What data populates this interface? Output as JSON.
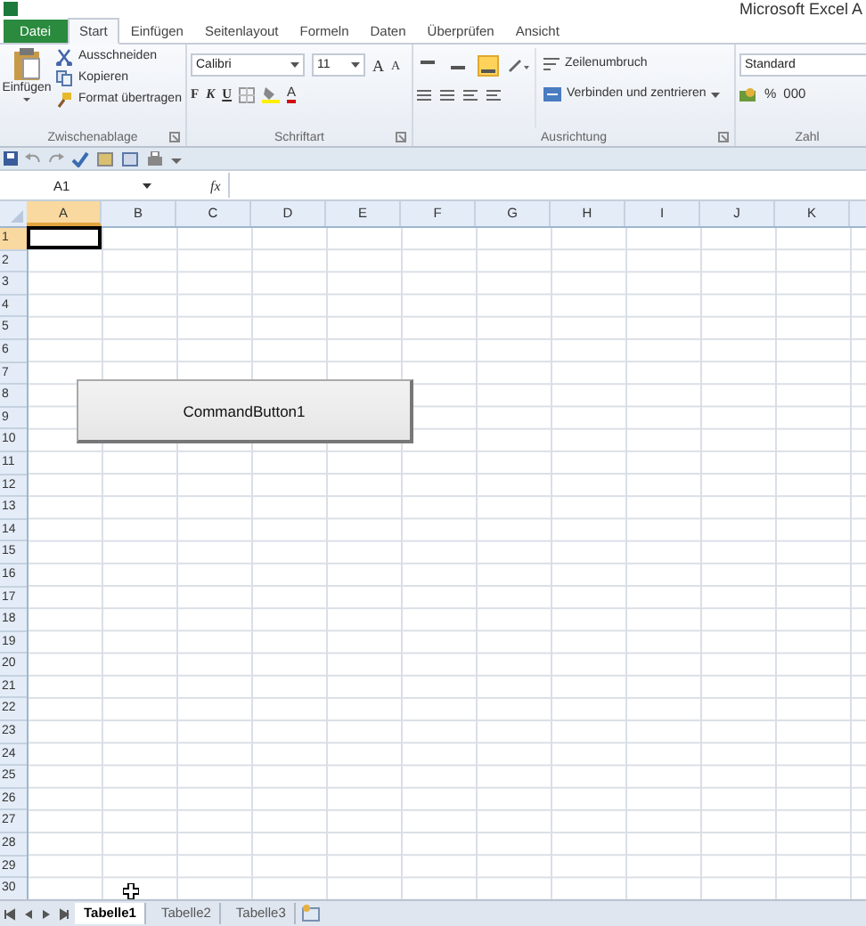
{
  "window": {
    "title": "Microsoft Excel A"
  },
  "ribbon_tabs": [
    {
      "label": "Datei",
      "kind": "file",
      "selected": false
    },
    {
      "label": "Start",
      "kind": "tab",
      "selected": true
    },
    {
      "label": "Einfügen",
      "kind": "tab",
      "selected": false
    },
    {
      "label": "Seitenlayout",
      "kind": "tab",
      "selected": false
    },
    {
      "label": "Formeln",
      "kind": "tab",
      "selected": false
    },
    {
      "label": "Daten",
      "kind": "tab",
      "selected": false
    },
    {
      "label": "Überprüfen",
      "kind": "tab",
      "selected": false
    },
    {
      "label": "Ansicht",
      "kind": "tab",
      "selected": false
    }
  ],
  "clipboard": {
    "label": "Zwischenablage",
    "paste": "Einfügen",
    "items": [
      {
        "label": "Ausschneiden",
        "kind": "cut"
      },
      {
        "label": "Kopieren",
        "kind": "copy"
      },
      {
        "label": "Format übertragen",
        "kind": "brush"
      }
    ]
  },
  "font": {
    "label": "Schriftart",
    "font_name": "Calibri",
    "font_size": "11",
    "grow": "A",
    "shrink": "A",
    "styles": [
      "F",
      "K",
      "U"
    ],
    "color_button": "A"
  },
  "alignment": {
    "label": "Ausrichtung",
    "vertical_align": [
      {
        "selected": false
      },
      {
        "selected": false
      },
      {
        "selected": true
      }
    ],
    "wrap": "Zeilenumbruch",
    "merge": "Verbinden und zentrieren"
  },
  "number": {
    "label": "Zahl",
    "format": "Standard",
    "percent": "%",
    "thousands": "000"
  },
  "name_box": "A1",
  "fx": "fx",
  "columns": [
    {
      "label": "A",
      "selected": true
    },
    {
      "label": "B",
      "selected": false
    },
    {
      "label": "C",
      "selected": false
    },
    {
      "label": "D",
      "selected": false
    },
    {
      "label": "E",
      "selected": false
    },
    {
      "label": "F",
      "selected": false
    },
    {
      "label": "G",
      "selected": false
    },
    {
      "label": "H",
      "selected": false
    },
    {
      "label": "I",
      "selected": false
    },
    {
      "label": "J",
      "selected": false
    },
    {
      "label": "K",
      "selected": false
    }
  ],
  "rows": [
    {
      "label": "1",
      "selected": true
    },
    {
      "label": "2",
      "selected": false
    },
    {
      "label": "3",
      "selected": false
    },
    {
      "label": "4",
      "selected": false
    },
    {
      "label": "5",
      "selected": false
    },
    {
      "label": "6",
      "selected": false
    },
    {
      "label": "7",
      "selected": false
    },
    {
      "label": "8",
      "selected": false
    },
    {
      "label": "9",
      "selected": false
    },
    {
      "label": "10",
      "selected": false
    },
    {
      "label": "11",
      "selected": false
    },
    {
      "label": "12",
      "selected": false
    },
    {
      "label": "13",
      "selected": false
    },
    {
      "label": "14",
      "selected": false
    },
    {
      "label": "15",
      "selected": false
    },
    {
      "label": "16",
      "selected": false
    },
    {
      "label": "17",
      "selected": false
    },
    {
      "label": "18",
      "selected": false
    },
    {
      "label": "19",
      "selected": false
    },
    {
      "label": "20",
      "selected": false
    },
    {
      "label": "21",
      "selected": false
    },
    {
      "label": "22",
      "selected": false
    },
    {
      "label": "23",
      "selected": false
    },
    {
      "label": "24",
      "selected": false
    },
    {
      "label": "25",
      "selected": false
    },
    {
      "label": "26",
      "selected": false
    },
    {
      "label": "27",
      "selected": false
    },
    {
      "label": "28",
      "selected": false
    },
    {
      "label": "29",
      "selected": false
    },
    {
      "label": "30",
      "selected": false
    }
  ],
  "command_button": {
    "label": "CommandButton1"
  },
  "sheets": [
    {
      "label": "Tabelle1",
      "selected": true
    },
    {
      "label": "Tabelle2",
      "selected": false
    },
    {
      "label": "Tabelle3",
      "selected": false
    }
  ]
}
